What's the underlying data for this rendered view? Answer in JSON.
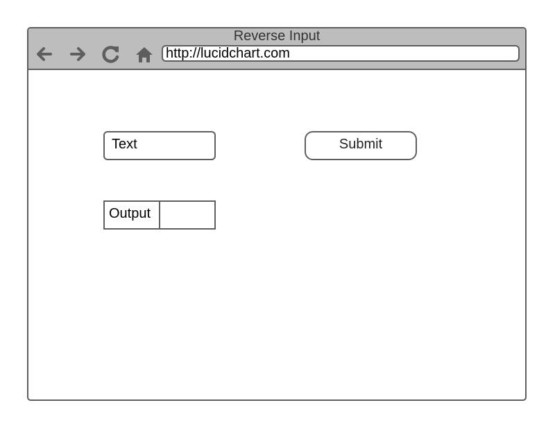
{
  "window": {
    "title": "Reverse Input"
  },
  "toolbar": {
    "icons": [
      "back-arrow-icon",
      "forward-arrow-icon",
      "refresh-icon",
      "home-icon"
    ],
    "address": "http://lucidchart.com"
  },
  "form": {
    "text_input_label": "Text",
    "submit_label": "Submit",
    "output_label": "Output",
    "output_value": ""
  },
  "colors": {
    "border": "#5e5e5e",
    "title_bar": "#bdbdbd",
    "background": "#ffffff"
  }
}
